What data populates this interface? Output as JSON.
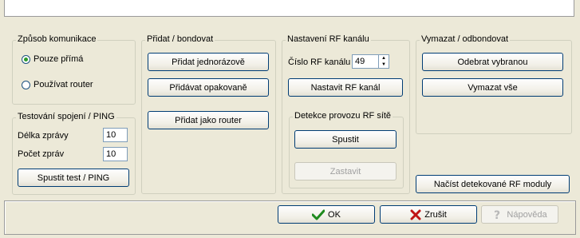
{
  "communication": {
    "title": "Způsob komunikace",
    "options": [
      {
        "label": "Pouze přímá",
        "selected": true
      },
      {
        "label": "Používat router",
        "selected": false
      }
    ]
  },
  "ping": {
    "title": "Testování spojení / PING",
    "length_label": "Délka zprávy",
    "length_value": "10",
    "count_label": "Počet zpráv",
    "count_value": "10",
    "run_button": "Spustit test / PING"
  },
  "pairing": {
    "title": "Přidat / bondovat",
    "add_once": "Přidat jednorázově",
    "add_repeat": "Přidávat opakovaně",
    "add_router": "Přidat jako router"
  },
  "rf": {
    "title": "Nastavení RF kanálu",
    "channel_label": "Číslo RF kanálu",
    "channel_value": "49",
    "set_button": "Nastavit RF kanál",
    "detect": {
      "title": "Detekce provozu RF sítě",
      "start_button": "Spustit",
      "stop_button": "Zastavit"
    }
  },
  "remove": {
    "title": "Vymazat / odbondovat",
    "remove_selected": "Odebrat vybranou",
    "remove_all": "Vymazat vše"
  },
  "load_button": "Načíst detekované RF moduly",
  "footer": {
    "ok": "OK",
    "cancel": "Zrušit",
    "help": "Nápověda"
  }
}
